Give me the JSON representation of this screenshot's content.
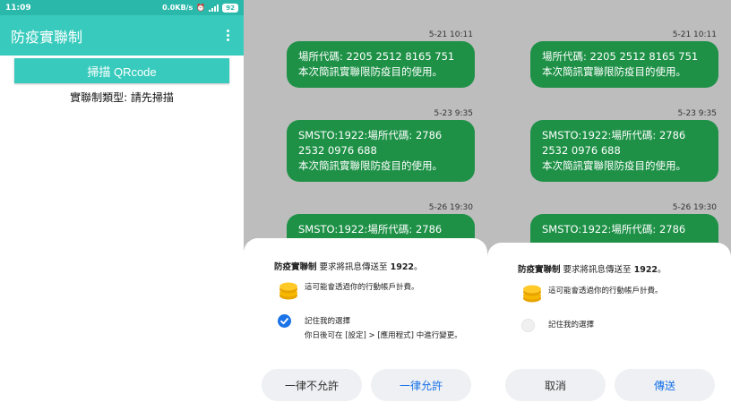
{
  "app": {
    "status": {
      "time": "11:09",
      "speed": "0.0KB/s",
      "battery": "92"
    },
    "title": "防疫實聯制",
    "scan_button": "掃描 QRcode",
    "type_line": "實聯制類型: 請先掃描"
  },
  "messages": [
    {
      "time": "5-21 10:11",
      "lines": [
        "場所代碼: 2205 2512 8165 751",
        "本次簡訊實聯限防疫目的使用。"
      ]
    },
    {
      "time": "5-23 9:35",
      "lines": [
        "SMSTO:1922:場所代碼: 2786",
        "2532 0976 688",
        "本次簡訊實聯限防疫目的使用。"
      ]
    },
    {
      "time": "5-26 19:30",
      "lines": [
        "SMSTO:1922:場所代碼: 2786"
      ]
    }
  ],
  "dialog_1": {
    "app_name": "防疫實聯制",
    "request_text": "要求將訊息傳送至",
    "number": "1922",
    "suffix": "。",
    "charge_notice": "這可能會透過你的行動帳戶計費。",
    "remember_label": "記住我的選擇",
    "remember_checked": true,
    "hint": "你日後可在 [設定] > [應用程式] 中進行變更。",
    "deny_button": "一律不允許",
    "allow_button": "一律允許"
  },
  "dialog_2": {
    "app_name": "防疫實聯制",
    "request_text": "要求將訊息傳送至",
    "number": "1922",
    "suffix": "。",
    "charge_notice": "這可能會透過你的行動帳戶計費。",
    "remember_label": "記住我的選擇",
    "remember_checked": false,
    "cancel_button": "取消",
    "send_button": "傳送"
  },
  "colors": {
    "teal": "#38cbbd",
    "bubble_green": "#1e9147",
    "accent_blue": "#1a73e8",
    "scrim": "#bdbdbd"
  }
}
